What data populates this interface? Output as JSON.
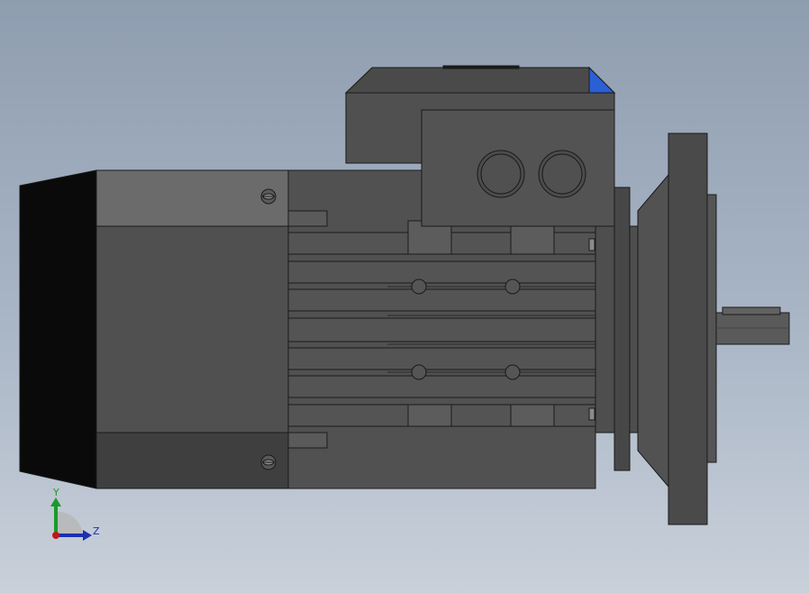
{
  "viewport": {
    "background_top": "#8f9db0",
    "background_bottom": "#c9d0da"
  },
  "triad": {
    "y_label": "Y",
    "z_label": "Z",
    "y_color": "#1a9a2a",
    "z_color": "#1c2fb0",
    "origin_color": "#c01818"
  },
  "model": {
    "body_color": "#505050",
    "light_face_color": "#6b6b6b",
    "fan_cover_color": "#0a0a0a",
    "accent_color": "#2a5fd6"
  }
}
